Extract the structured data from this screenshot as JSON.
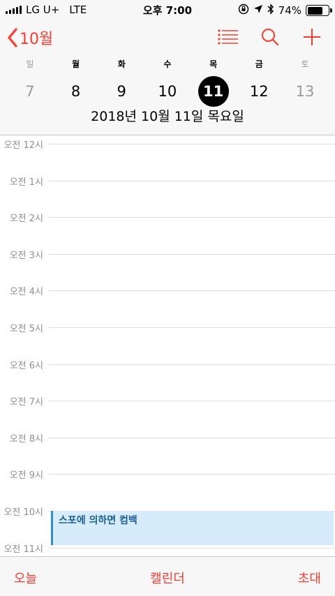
{
  "status_bar": {
    "carrier": "LG U+",
    "network": "LTE",
    "time": "오후 7:00",
    "battery": "74%",
    "battery_level": 0.74
  },
  "header": {
    "back_label": "10월",
    "accent_color": "#ff3b30",
    "weekdays": [
      "일",
      "월",
      "화",
      "수",
      "목",
      "금",
      "토"
    ],
    "days": [
      "7",
      "8",
      "9",
      "10",
      "11",
      "12",
      "13"
    ],
    "selected_day": "11",
    "date_title": "2018년 10월 11일 목요일"
  },
  "timeline": {
    "hours": [
      "오전 12시",
      "오전 1시",
      "오전 2시",
      "오전 3시",
      "오전 4시",
      "오전 5시",
      "오전 6시",
      "오전 7시",
      "오전 8시",
      "오전 9시",
      "오전 10시",
      "오전 11시"
    ],
    "event": {
      "title": "스포에 의하면 컴백",
      "color": "#2d8fd5"
    }
  },
  "tab_bar": {
    "today": "오늘",
    "calendars": "캘린더",
    "inbox": "초대"
  }
}
